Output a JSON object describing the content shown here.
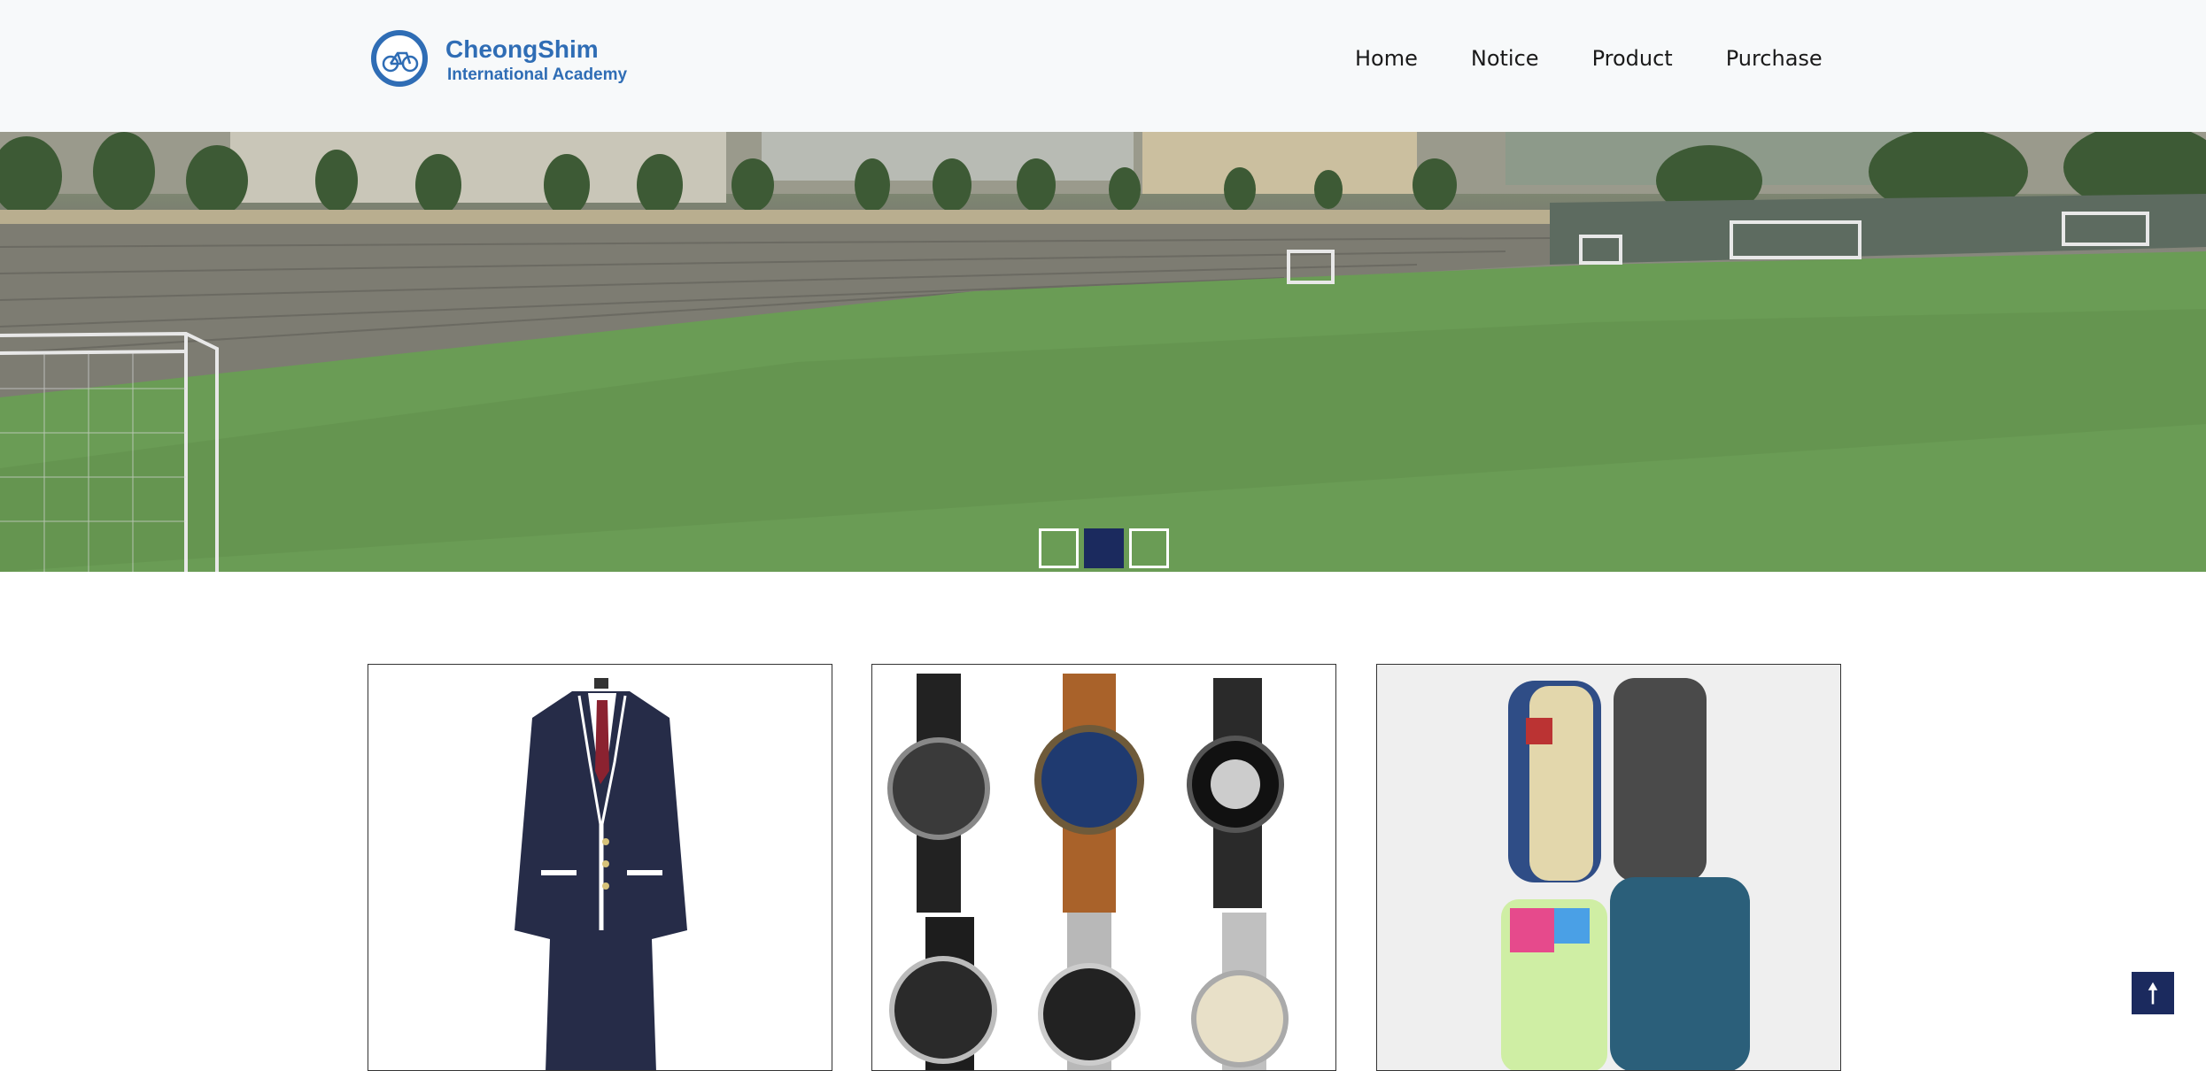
{
  "brand": {
    "name": "CheongShim",
    "subtitle": "International Academy",
    "color": "#2f6db5"
  },
  "nav": {
    "items": [
      {
        "label": "Home"
      },
      {
        "label": "Notice"
      },
      {
        "label": "Product"
      },
      {
        "label": "Purchase"
      }
    ]
  },
  "hero": {
    "image": "campus soccer field",
    "slides": 3,
    "active_slide": 2,
    "accent": "#1b2a5e"
  },
  "products": [
    {
      "image": "school uniform blazer"
    },
    {
      "image": "wrist watches"
    },
    {
      "image": "pencil cases"
    }
  ],
  "scroll_top": {
    "icon": "arrow-up-icon",
    "glyph": "🠕"
  }
}
